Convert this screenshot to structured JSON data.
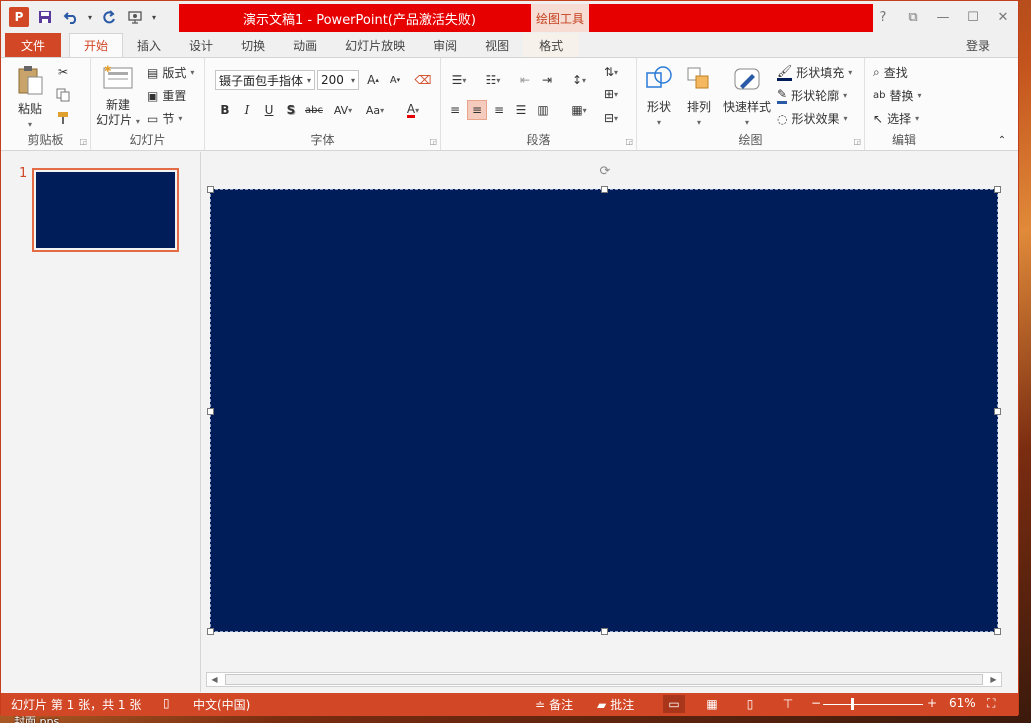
{
  "window": {
    "title": "演示文稿1 - PowerPoint(产品激活失败)",
    "context_tool": "绘图工具",
    "logo": "P"
  },
  "window_controls": {
    "help": "?",
    "ribbon_display": "⧉",
    "minimize": "—",
    "restore": "☐",
    "close": "✕"
  },
  "tabs": [
    {
      "label": "文件"
    },
    {
      "label": "开始"
    },
    {
      "label": "插入"
    },
    {
      "label": "设计"
    },
    {
      "label": "切换"
    },
    {
      "label": "动画"
    },
    {
      "label": "幻灯片放映"
    },
    {
      "label": "审阅"
    },
    {
      "label": "视图"
    },
    {
      "label": "格式"
    }
  ],
  "login": "登录",
  "ribbon": {
    "clipboard": {
      "label": "剪贴板",
      "paste": "粘贴"
    },
    "slides": {
      "label": "幻灯片",
      "new_slide_line1": "新建",
      "new_slide_line2": "幻灯片",
      "layout": "版式",
      "reset": "重置",
      "section": "节"
    },
    "font": {
      "label": "字体",
      "font_name": "镊子面包手指体",
      "font_size": "200",
      "bold": "B",
      "italic": "I",
      "underline": "U",
      "shadow": "S",
      "strike": "abc",
      "spacing": "AV",
      "case": "Aa",
      "color": "A"
    },
    "paragraph": {
      "label": "段落"
    },
    "drawing": {
      "label": "绘图",
      "shapes": "形状",
      "arrange": "排列",
      "quick_styles": "快速样式",
      "fill": "形状填充",
      "outline": "形状轮廓",
      "effects": "形状效果"
    },
    "editing": {
      "label": "编辑",
      "find": "查找",
      "replace": "替换",
      "select": "选择"
    }
  },
  "thumbnails": [
    {
      "number": "1"
    }
  ],
  "statusbar": {
    "slide_info": "幻灯片 第 1 张，共 1 张",
    "language": "中文(中国)",
    "notes": "备注",
    "comments": "批注",
    "zoom": "61%",
    "zoom_minus": "−",
    "zoom_plus": "+"
  },
  "desktop_label": "封面.pps",
  "colors": {
    "accent": "#d24726",
    "title_red": "#e60000",
    "slide_bg": "#001d5a"
  }
}
